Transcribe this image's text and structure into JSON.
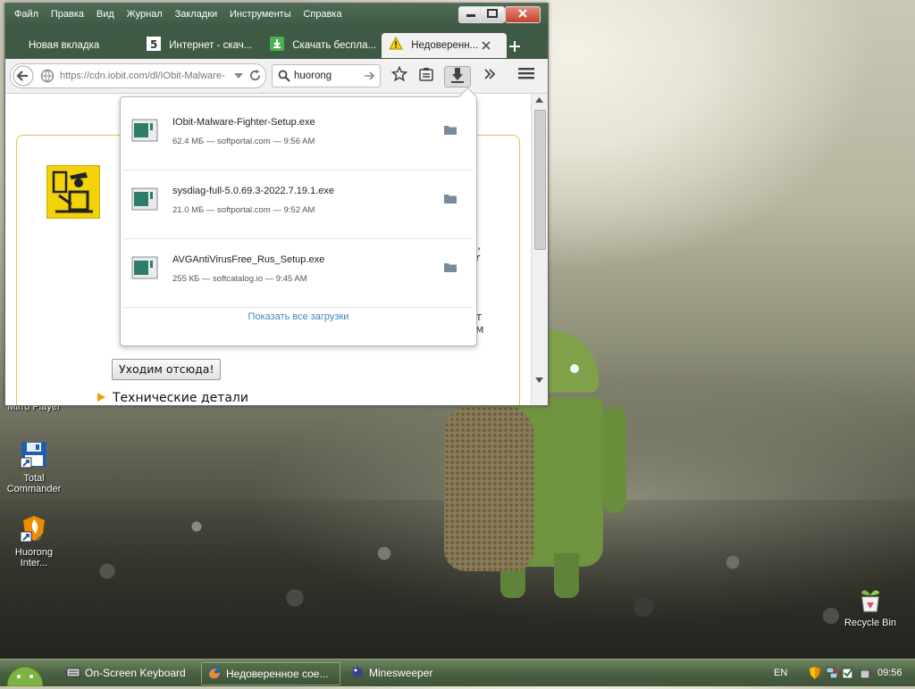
{
  "desktop": {
    "icons": [
      {
        "label": "Mirro Player"
      },
      {
        "label": "Total Commander"
      },
      {
        "label": "Huorong Inter..."
      },
      {
        "label": "Recycle Bin"
      }
    ]
  },
  "browser": {
    "menu": [
      "Файл",
      "Правка",
      "Вид",
      "Журнал",
      "Закладки",
      "Инструменты",
      "Справка"
    ],
    "tabs": [
      {
        "label": "Новая вкладка"
      },
      {
        "label": "Интернет - скач..."
      },
      {
        "label": "Скачать беспла..."
      },
      {
        "label": "Недоверенн..."
      }
    ],
    "url": "https://cdn.iobit.com/dl/IObit-Malware-",
    "search_value": "huorong",
    "content": {
      "leave_button": "Уходим отсюда!",
      "technical_details": "Технические детали",
      "fragments": [
        "o",
        "D,",
        "or",
        "ет",
        "ам"
      ]
    }
  },
  "downloads": {
    "items": [
      {
        "name": "IObit-Malware-Fighter-Setup.exe",
        "meta": "62.4 МБ — softportal.com — 9:56 AM"
      },
      {
        "name": "sysdiag-full-5.0.69.3-2022.7.19.1.exe",
        "meta": "21.0 МБ — softportal.com — 9:52 AM"
      },
      {
        "name": "AVGAntiVirusFree_Rus_Setup.exe",
        "meta": "255 КБ — softcatalog.io — 9:45 AM"
      }
    ],
    "show_all": "Показать все загрузки"
  },
  "taskbar": {
    "tasks": [
      {
        "label": "On-Screen Keyboard"
      },
      {
        "label": "Недоверенное сое..."
      },
      {
        "label": "Minesweeper"
      }
    ],
    "lang": "EN",
    "clock": "09:56"
  },
  "colors": {
    "accent": "#3f88b8",
    "frame": "#3e5a45",
    "warning": "#f5d000"
  }
}
